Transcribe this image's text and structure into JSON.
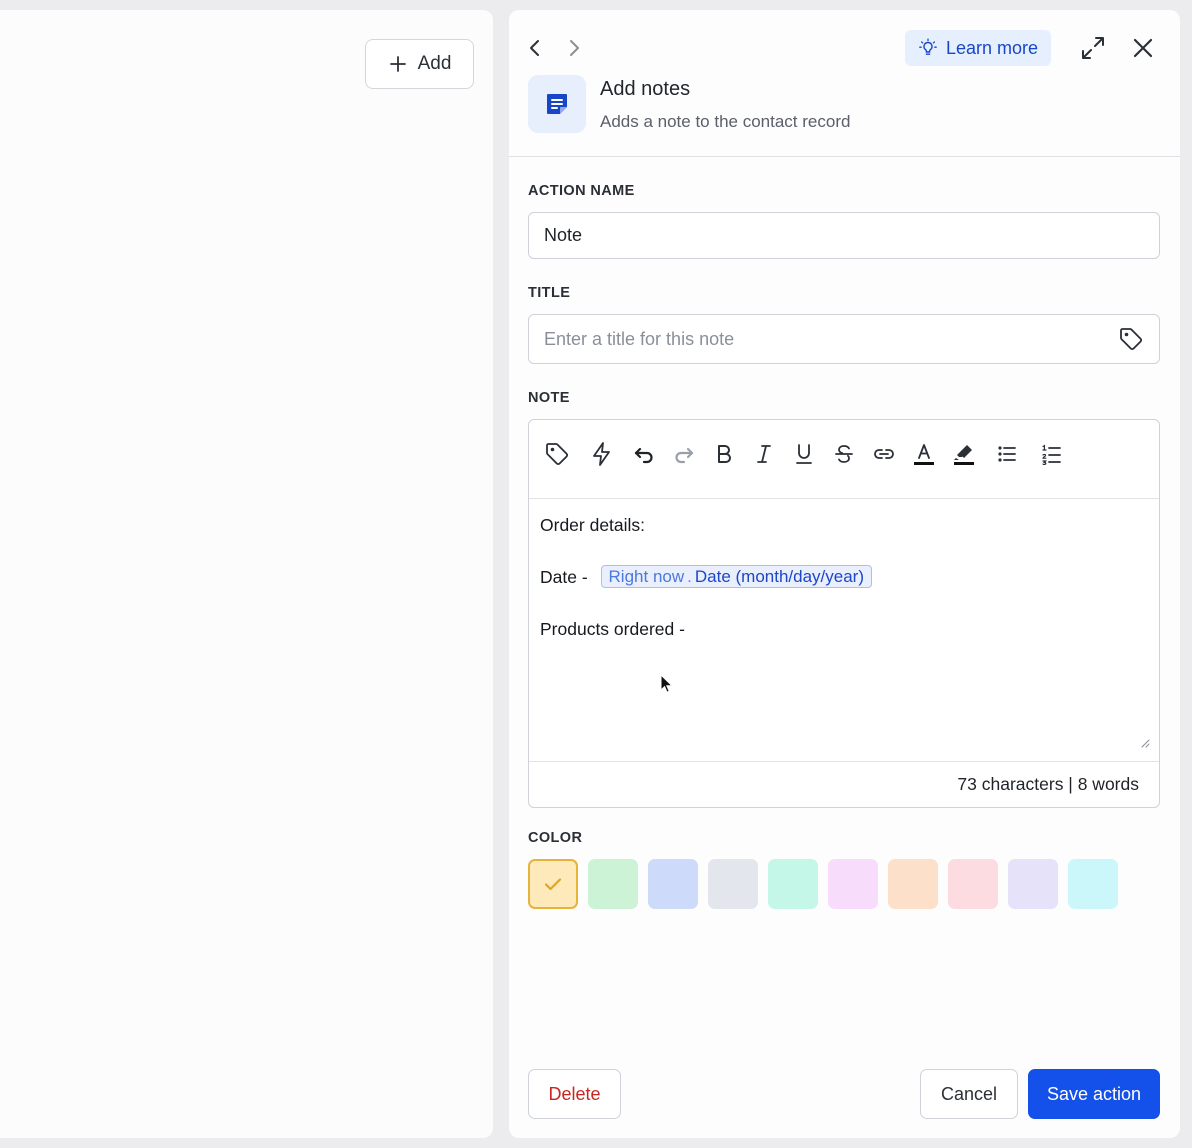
{
  "canvas": {
    "add_button_label": "Add"
  },
  "panel": {
    "learn_more_label": "Learn more",
    "action": {
      "title": "Add notes",
      "description": "Adds a note to the contact record"
    },
    "fields": {
      "action_name": {
        "label": "ACTION NAME",
        "value": "Note"
      },
      "title": {
        "label": "TITLE",
        "placeholder": "Enter a title for this note"
      },
      "note": {
        "label": "NOTE",
        "toolbar": [
          "tag-icon",
          "lightning-icon",
          "undo-icon",
          "redo-icon",
          "bold-icon",
          "italic-icon",
          "underline-icon",
          "strikethrough-icon",
          "link-icon",
          "text-color-icon",
          "highlight-icon",
          "bullet-list-icon",
          "numbered-list-icon"
        ],
        "lines": {
          "line1": "Order details:",
          "line2_prefix": "Date -",
          "merge_source": "Right now",
          "merge_sep": ".",
          "merge_field": "Date (month/day/year)",
          "line3": "Products ordered -"
        },
        "counter": "73 characters | 8 words"
      },
      "color": {
        "label": "COLOR",
        "swatches": [
          "#fde9b9",
          "#cdf3d6",
          "#cddafa",
          "#e4e6ee",
          "#c5f7e9",
          "#f7dcfb",
          "#fde0c9",
          "#fcdce0",
          "#e5e2fa",
          "#cbf7fb"
        ],
        "selected_index": 0
      }
    },
    "buttons": {
      "delete": "Delete",
      "cancel": "Cancel",
      "save": "Save action"
    }
  },
  "colors": {
    "primary": "#1450ea",
    "danger": "#c8261f",
    "learn_more_bg": "#e6effd"
  }
}
